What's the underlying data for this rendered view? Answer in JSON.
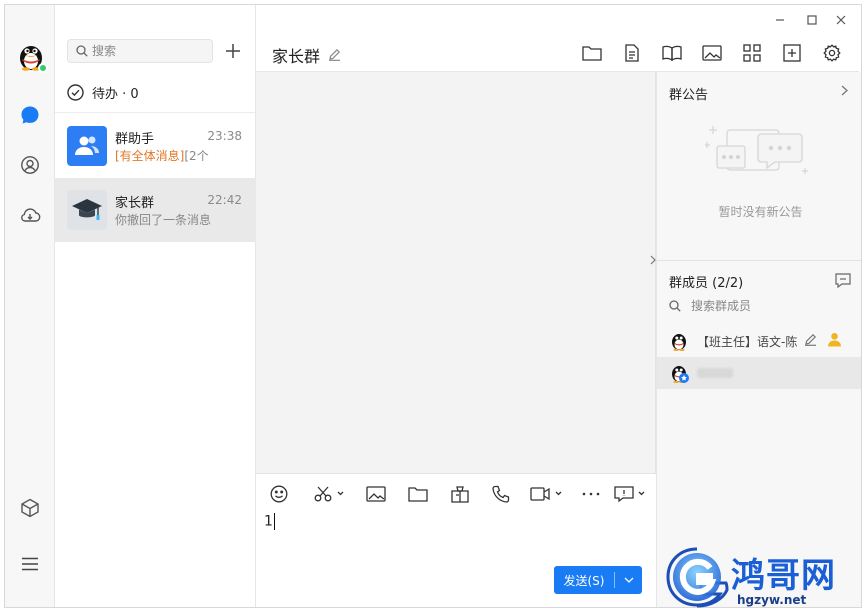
{
  "window": {
    "controls": [
      "minimize-icon",
      "maximize-icon",
      "close-icon"
    ]
  },
  "rail": {
    "items": [
      {
        "name": "chat-icon",
        "active": true
      },
      {
        "name": "contacts-icon"
      },
      {
        "name": "cloud-icon"
      }
    ],
    "bottom": [
      "app-box-icon",
      "menu-icon"
    ],
    "accent": "#1a7cf5",
    "online_color": "#2fcc71"
  },
  "search": {
    "placeholder": "搜索"
  },
  "todo": {
    "label": "待办 · 0"
  },
  "conversations": [
    {
      "name": "群助手",
      "time": "23:38",
      "highlight": "[有全体消息]",
      "message": "[2个",
      "avatar_color": "#2d7ef5"
    },
    {
      "name": "家长群",
      "time": "22:42",
      "highlight": "",
      "message": "你撤回了一条消息",
      "avatar_color": "#dfe3e8"
    }
  ],
  "chat": {
    "title": "家长群",
    "input_text": "1",
    "send_label": "发送(S)",
    "header_icons": [
      "folder-icon",
      "document-icon",
      "book-icon",
      "image-icon",
      "apps-grid-icon",
      "add-app-icon",
      "settings-icon"
    ],
    "toolbar_icons": [
      "emoji-icon",
      "scissors-icon",
      "image-icon",
      "folder-icon",
      "gift-icon",
      "phone-icon",
      "video-icon",
      "more-icon",
      "screen-share-icon"
    ]
  },
  "side": {
    "announcement_title": "群公告",
    "announcement_empty": "暂时没有新公告",
    "members_title": "群成员 (2/2)",
    "member_search_placeholder": "搜索群成员",
    "members": [
      {
        "name": "【班主任】语文-陈",
        "role": "admin"
      },
      {
        "name": "",
        "role": "member"
      }
    ]
  },
  "watermark": {
    "title": "鸿哥网",
    "url": "hgzyw.net"
  }
}
